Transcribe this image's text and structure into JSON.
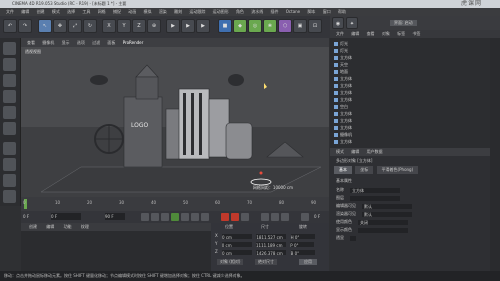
{
  "window": {
    "title": "CINEMA 4D R19.053 Studio (RC - R19) - [未标题 1 *] - 主要",
    "watermark": "虎课网"
  },
  "menu": [
    "文件",
    "编辑",
    "创建",
    "模式",
    "选择",
    "工具",
    "网格",
    "捕捉",
    "动画",
    "模拟",
    "渲染",
    "雕刻",
    "运动跟踪",
    "运动图形",
    "角色",
    "流水线",
    "插件",
    "Octane",
    "脚本",
    "窗口",
    "帮助"
  ],
  "toolbar": {
    "buttons": [
      "↶",
      "↷",
      "↖",
      "✥",
      "⤢",
      "↻",
      "X",
      "Y",
      "Z",
      "⊕",
      "▶",
      "▶",
      "▶",
      "■",
      "◆",
      "◎",
      "❀",
      "⬡",
      "▣",
      "⊡",
      "◉",
      "✦"
    ]
  },
  "viewport": {
    "menu": [
      "查看",
      "摄像机",
      "显示",
      "选项",
      "过滤",
      "面板",
      "ProRender"
    ],
    "label": "透视视图",
    "grid_text": "网格间距：10000 cm",
    "logo_text": "LOGO"
  },
  "timeline": {
    "ticks": [
      "0",
      "10",
      "20",
      "30",
      "40",
      "50",
      "60",
      "70",
      "80",
      "90"
    ],
    "start": "0 F",
    "fields": [
      "0 F",
      "90 F",
      "90 F"
    ],
    "frame": "0 F"
  },
  "materials": {
    "tabs": [
      "创建",
      "编辑",
      "功能",
      "纹理"
    ]
  },
  "coords": {
    "headers": [
      "位置",
      "尺寸",
      "旋转"
    ],
    "rows": [
      {
        "axis": "X",
        "pos": "0 cm",
        "size": "1811.527 cm",
        "rot": "H 0°"
      },
      {
        "axis": "Y",
        "pos": "0 cm",
        "size": "1111.189 cm",
        "rot": "P 0°"
      },
      {
        "axis": "Z",
        "pos": "0 cm",
        "size": "1426.378 cm",
        "rot": "B 0°"
      }
    ],
    "mode": "对象 (相对)",
    "mode2": "绝对尺寸",
    "apply": "应用"
  },
  "right": {
    "top_label": "界面: 启动",
    "menu": [
      "文件",
      "编辑",
      "查看",
      "对象",
      "标签",
      "书签"
    ],
    "objects": [
      "灯光",
      "灯光",
      "立方体",
      "天空",
      "地面",
      "立方体",
      "立方体",
      "立方体",
      "立方体",
      "空白",
      "立方体",
      "立方体",
      "立方体",
      "摄像机",
      "立方体"
    ]
  },
  "attributes": {
    "header": [
      "模式",
      "编辑",
      "用户数据"
    ],
    "title": "多边形对象 [立方体]",
    "tabs": [
      "基本",
      "坐标",
      "平滑着色(Phong)"
    ],
    "section": "基本属性",
    "rows": [
      {
        "label": "名称",
        "value": "立方体"
      },
      {
        "label": "图层",
        "value": ""
      },
      {
        "label": "编辑器可见",
        "value": "默认"
      },
      {
        "label": "渲染器可见",
        "value": "默认"
      },
      {
        "label": "使用颜色",
        "value": "关闭"
      },
      {
        "label": "显示颜色",
        "value": ""
      },
      {
        "label": "透显",
        "value": ""
      }
    ]
  },
  "status": "移动：点击并拖动鼠标移动元素。按住 SHIFT 键量化移动；节点编辑模式时按住 SHIFT 键增加选择对象；按住 CTRL 键减少选择对象。"
}
